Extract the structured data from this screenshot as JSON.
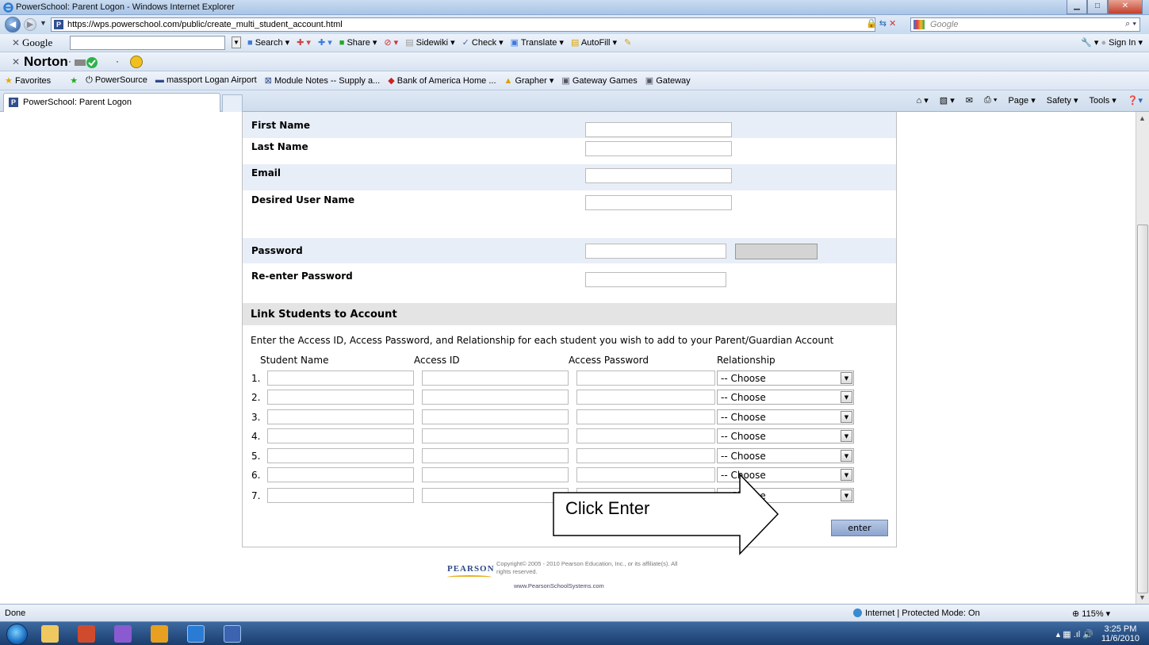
{
  "window": {
    "title": "PowerSchool: Parent Logon - Windows Internet Explorer"
  },
  "address": {
    "url": "https://wps.powerschool.com/public/create_multi_student_account.html",
    "search_placeholder": "Google"
  },
  "google_toolbar": {
    "logo": "Google",
    "search_label": "Search",
    "share": "Share",
    "sidewiki": "Sidewiki",
    "check": "Check",
    "translate": "Translate",
    "autofill": "AutoFill",
    "sign_in": "Sign In"
  },
  "norton": {
    "label": "Norton"
  },
  "favorites": {
    "label": "Favorites",
    "items": [
      "PowerSource",
      "massport Logan Airport",
      "Module Notes -- Supply a...",
      "Bank of America Home ...",
      "Grapher",
      "Gateway Games",
      "Gateway"
    ]
  },
  "tab": {
    "title": "PowerSchool: Parent Logon"
  },
  "command_bar": {
    "page": "Page",
    "safety": "Safety",
    "tools": "Tools"
  },
  "form": {
    "fields": [
      {
        "label": "First Name"
      },
      {
        "label": "Last Name"
      },
      {
        "label": "Email"
      },
      {
        "label": "Desired User Name"
      },
      {
        "label": "Password"
      },
      {
        "label": "Re-enter Password"
      }
    ],
    "section_title": "Link Students to Account",
    "instructions": "Enter the Access ID, Access Password, and Relationship for each student you wish to add to your Parent/Guardian Account",
    "columns": {
      "student_name": "Student Name",
      "access_id": "Access ID",
      "access_password": "Access Password",
      "relationship": "Relationship"
    },
    "rows": [
      {
        "num": "1.",
        "relationship": "-- Choose"
      },
      {
        "num": "2.",
        "relationship": "-- Choose"
      },
      {
        "num": "3.",
        "relationship": "-- Choose"
      },
      {
        "num": "4.",
        "relationship": "-- Choose"
      },
      {
        "num": "5.",
        "relationship": "-- Choose"
      },
      {
        "num": "6.",
        "relationship": "-- Choose"
      },
      {
        "num": "7.",
        "relationship": "-- Choose"
      }
    ],
    "annotation": "Click Enter",
    "enter_label": "enter"
  },
  "footer": {
    "logo": "PEARSON",
    "copyright": "Copyright© 2005 - 2010 Pearson Education, Inc., or its affiliate(s). All rights reserved.",
    "link": "www.PearsonSchoolSystems.com"
  },
  "status": {
    "left": "Done",
    "zone": "Internet | Protected Mode: On",
    "zoom": "115%"
  },
  "taskbar": {
    "time": "3:25 PM",
    "date": "11/6/2010"
  }
}
